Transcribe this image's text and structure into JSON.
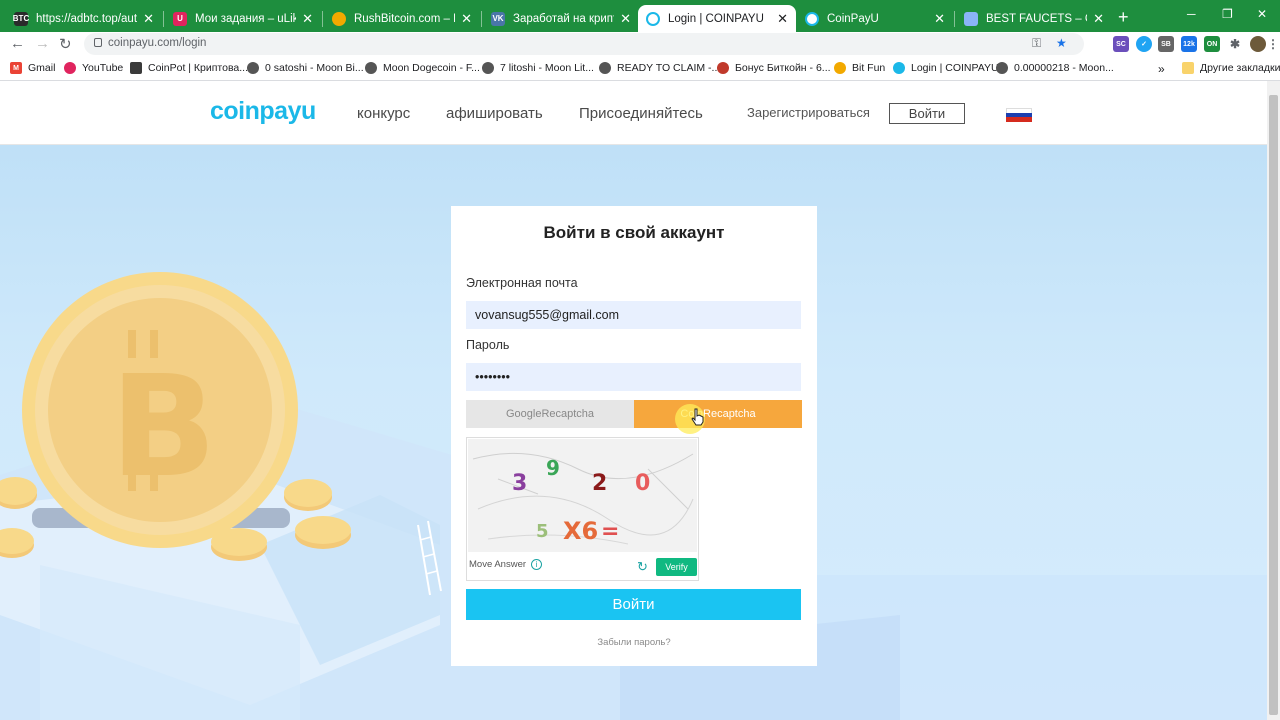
{
  "browser": {
    "tabs": [
      {
        "title": "https://adbtc.top/autosurf",
        "favicon": "BTC",
        "favicon_color": "#2b2b2b"
      },
      {
        "title": "Мои задания – uLike",
        "favicon": "U",
        "favicon_color": "#e0245e"
      },
      {
        "title": "RushBitcoin.com – Promoti",
        "favicon": "",
        "favicon_color": "#f2a900"
      },
      {
        "title": "Заработай на криптовалю",
        "favicon": "VK",
        "favicon_color": "#4a76a8"
      },
      {
        "title": "Login | COINPAYU",
        "favicon": "",
        "favicon_color": "#1bb8e8",
        "active": true
      },
      {
        "title": "CoinPayU",
        "favicon": "",
        "favicon_color": "#1bb8e8"
      },
      {
        "title": "BEST FAUCETS – GET CRYP",
        "favicon": "",
        "favicon_color": "#8ab4f8"
      }
    ],
    "new_tab_symbol": "+",
    "close_symbol": "✕",
    "window_controls": {
      "minimize": "─",
      "restore": "❐",
      "close": "✕"
    },
    "nav": {
      "back": "←",
      "forward": "→",
      "reload": "↻"
    },
    "url": "coinpayu.com/login",
    "extensions": [
      {
        "label": "SC",
        "color": "#6b4fbb"
      },
      {
        "label": "✓",
        "color": "#20a4f3"
      },
      {
        "label": "SB",
        "color": "#666666",
        "badge": "8"
      },
      {
        "label": "12k",
        "color": "#1a73e8"
      },
      {
        "label": "ON",
        "color": "#1e8e3e"
      }
    ],
    "bookmarks": [
      {
        "label": "Gmail",
        "icon_color": "#ea4335",
        "icon": "M"
      },
      {
        "label": "YouTube",
        "icon_color": "#ff0000",
        "icon": "▶"
      },
      {
        "label": "CoinPot | Криптова...",
        "icon_color": "#3a3a3a",
        "icon": ""
      },
      {
        "label": "0 satoshi - Moon Bi...",
        "icon_color": "#555555",
        "icon": ""
      },
      {
        "label": "Moon Dogecoin - F...",
        "icon_color": "#555555",
        "icon": ""
      },
      {
        "label": "7 litoshi - Moon Lit...",
        "icon_color": "#555555",
        "icon": ""
      },
      {
        "label": "READY TO CLAIM -...",
        "icon_color": "#555555",
        "icon": ""
      },
      {
        "label": "Бонус Биткойн - 6...",
        "icon_color": "#c0392b",
        "icon": ""
      },
      {
        "label": "Bit Fun",
        "icon_color": "#f2a900",
        "icon": ""
      },
      {
        "label": "Login | COINPAYU",
        "icon_color": "#1bb8e8",
        "icon": ""
      },
      {
        "label": "0.00000218 - Moon...",
        "icon_color": "#555555",
        "icon": ""
      }
    ],
    "more_bookmarks_symbol": "»",
    "other_bookmarks": "Другие закладки"
  },
  "site": {
    "logo": "coinpayu",
    "nav": [
      "конкурс",
      "афишировать",
      "Присоединяйтесь"
    ],
    "register": "Зарегистрироваться",
    "login": "Войти",
    "flag_colors": [
      "#ffffff",
      "#1c3fb0",
      "#d52b1e"
    ]
  },
  "login_form": {
    "title": "Войти в свой аккаунт",
    "email_label": "Электронная почта",
    "email_value": "vovansug555@gmail.com",
    "password_label": "Пароль",
    "password_value": "••••••••",
    "captcha_tabs": [
      "GoogleRecaptcha",
      "CoinRecaptcha"
    ],
    "captcha_digits": [
      "3",
      "9",
      "2",
      "0",
      "5",
      "X6",
      "="
    ],
    "captcha_hint": "Move Answer",
    "captcha_info_icon": "i",
    "captcha_refresh_icon": "↻",
    "verify": "Verify",
    "submit": "Войти",
    "forgot": "Забыли пароль?"
  }
}
